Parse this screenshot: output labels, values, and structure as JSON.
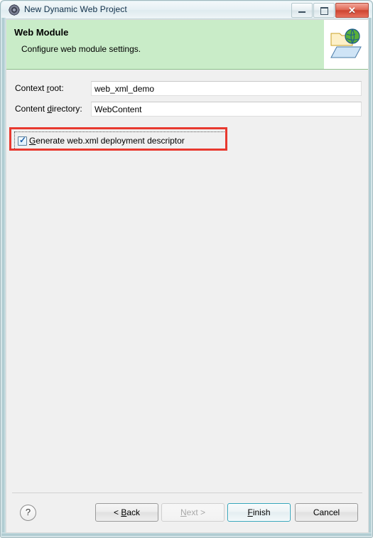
{
  "window": {
    "title": "New Dynamic Web Project",
    "title_icon": "eclipse-wizard-icon",
    "controls": {
      "minimize": "minimize-icon",
      "maximize": "maximize-icon",
      "close": "✕"
    }
  },
  "banner": {
    "title": "Web Module",
    "subtitle": "Configure web module settings.",
    "icon": "web-folder-globe-icon",
    "background_color": "#c9ecc8"
  },
  "form": {
    "fields": [
      {
        "label_pre": "Context ",
        "label_mnemonic": "r",
        "label_post": "oot:",
        "value": "web_xml_demo",
        "placeholder": ""
      },
      {
        "label_pre": "Content ",
        "label_mnemonic": "d",
        "label_post": "irectory:",
        "value": "WebContent",
        "placeholder": ""
      }
    ],
    "checkbox": {
      "checked": true,
      "check_glyph": "✓",
      "label_mnemonic": "G",
      "label_post": "enerate web.xml deployment descriptor"
    }
  },
  "annotation": {
    "color": "#e8392f",
    "target": "generate-webxml-checkbox"
  },
  "footer": {
    "help_label": "?",
    "buttons": [
      {
        "id": "back",
        "pre": "< ",
        "mnemonic": "B",
        "post": "ack",
        "enabled": true,
        "default": false
      },
      {
        "id": "next",
        "pre": "",
        "mnemonic": "N",
        "post": "ext >",
        "enabled": false,
        "default": false
      },
      {
        "id": "finish",
        "pre": "",
        "mnemonic": "F",
        "post": "inish",
        "enabled": true,
        "default": true
      },
      {
        "id": "cancel",
        "pre": "",
        "mnemonic": "",
        "post": "Cancel",
        "enabled": true,
        "default": false
      }
    ]
  }
}
